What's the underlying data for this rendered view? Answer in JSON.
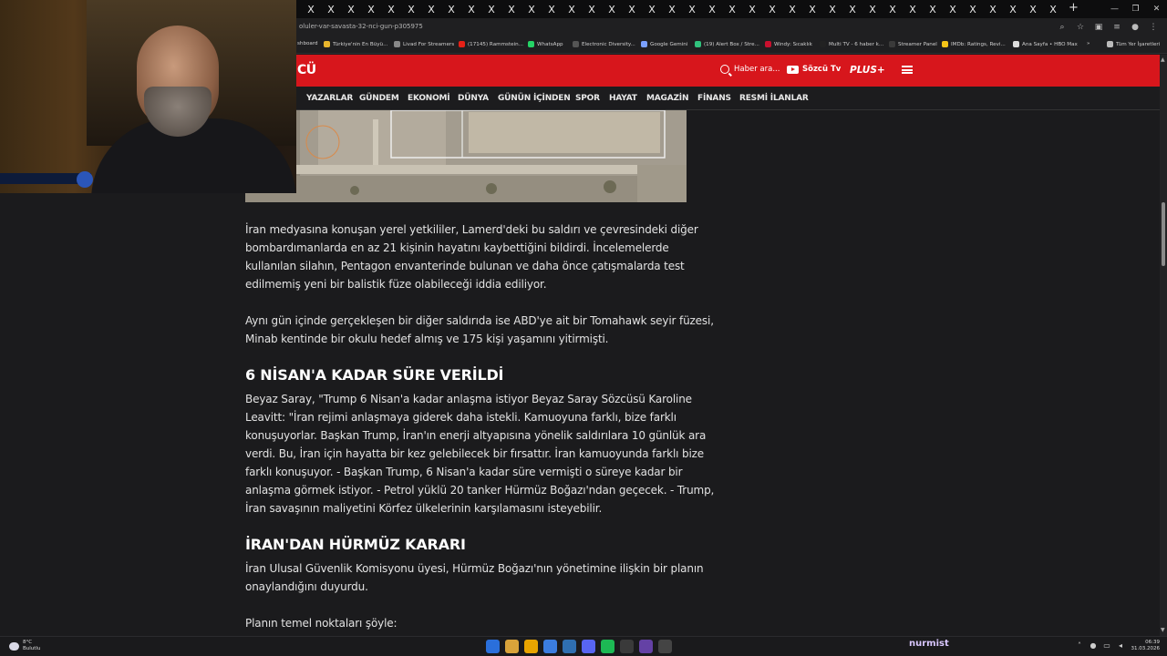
{
  "browser": {
    "tabs": [
      "X",
      "X",
      "X",
      "X",
      "X",
      "X",
      "X",
      "X",
      "X",
      "X",
      "X",
      "X",
      "X",
      "X",
      "X",
      "X",
      "X",
      "X",
      "X",
      "X",
      "X",
      "X",
      "X",
      "X",
      "X",
      "X",
      "X",
      "X",
      "X",
      "X",
      "X",
      "X",
      "X",
      "X",
      "X",
      "X",
      "X",
      "X"
    ],
    "new_tab": "+",
    "url": "oluler-var-savasta-32-nci-gun-p305975",
    "bookmarks": [
      {
        "label": "shboard",
        "icon_color": ""
      },
      {
        "label": "Türkiye'nin En Büyü...",
        "icon_color": "#e8b52c"
      },
      {
        "label": "Livad For Streamers",
        "icon_color": "#888888"
      },
      {
        "label": "(17145) Rammstein...",
        "icon_color": "#e62117"
      },
      {
        "label": "WhatsApp",
        "icon_color": "#25d366"
      },
      {
        "label": "Electronic Diversity...",
        "icon_color": "#555555"
      },
      {
        "label": "Google Gemini",
        "icon_color": "#7aa0ff"
      },
      {
        "label": "(19) Alert Box / Stre...",
        "icon_color": "#30c27d"
      },
      {
        "label": "Windy: Sıcaklık",
        "icon_color": "#c8102e"
      },
      {
        "label": "Multi TV - 6 haber k...",
        "icon_color": "#222222"
      },
      {
        "label": "Streamer Panel",
        "icon_color": "#3a3a3a"
      },
      {
        "label": "IMDb: Ratings, Revi...",
        "icon_color": "#f5c518"
      },
      {
        "label": "Ana Sayfa • HBO Max",
        "icon_color": "#dddddd"
      },
      {
        "label": "»",
        "icon_color": ""
      },
      {
        "label": "Tüm Yer İşaretleri",
        "icon_color": "#bbbbbb"
      }
    ]
  },
  "site": {
    "logo_text": "CÜ",
    "search_label": "Haber ara...",
    "tv_label": "Sözcü Tv",
    "plus_label": "PLUS+",
    "nav": [
      "YAZARLAR",
      "GÜNDEM",
      "EKONOMİ",
      "DÜNYA",
      "GÜNÜN İÇİNDEN",
      "SPOR",
      "HAYAT",
      "MAGAZİN",
      "FİNANS",
      "RESMİ İLANLAR"
    ],
    "brand_color": "#d7161c"
  },
  "article": {
    "p1_lines": [
      "İran medyasına konuşan yerel yetkililer, Lamerd'deki bu saldırı ve çevresindeki diğer",
      "bombardımanlarda en az 21 kişinin hayatını kaybettiğini bildirdi. İncelemelerde",
      "kullanılan silahın, Pentagon envanterinde bulunan ve daha önce çatışmalarda test",
      "edilmemiş yeni bir balistik füze olabileceği iddia ediliyor."
    ],
    "p2_lines": [
      "Aynı gün içinde gerçekleşen bir diğer saldırıda ise ABD'ye ait bir Tomahawk seyir füzesi,",
      "Minab kentinde bir okulu hedef almış ve 175 kişi yaşamını yitirmişti."
    ],
    "h1": "6 NİSAN'A KADAR SÜRE VERİLDİ",
    "p3_lines": [
      "Beyaz Saray, \"Trump 6 Nisan'a kadar anlaşma istiyor Beyaz Saray Sözcüsü Karoline",
      "Leavitt: \"İran rejimi anlaşmaya giderek daha istekli. Kamuoyuna farklı, bize farklı",
      "konuşuyorlar. Başkan Trump, İran'ın enerji altyapısına yönelik saldırılara 10 günlük ara",
      "verdi. Bu, İran için hayatta bir kez gelebilecek bir fırsattır. İran kamuoyunda farklı bize",
      "farklı konuşuyor. - Başkan Trump, 6 Nisan'a kadar süre vermişti o süreye kadar bir",
      "anlaşma görmek istiyor. - Petrol yüklü 20 tanker Hürmüz Boğazı'ndan geçecek. - Trump,",
      "İran savaşının maliyetini Körfez ülkelerinin karşılamasını isteyebilir."
    ],
    "h2": "İRAN'DAN HÜRMÜZ KARARI",
    "p4_lines": [
      "İran Ulusal Güvenlik Komisyonu üyesi, Hürmüz Boğazı'nın yönetimine ilişkin bir planın",
      "onaylandığını duyurdu."
    ],
    "p5": "Planın temel noktaları şöyle:"
  },
  "taskbar": {
    "weather_temp": "8°C",
    "weather_desc": "Bulutlu",
    "streamer_name": "nurmist",
    "time": "06:39",
    "date": "31.03.2026",
    "app_colors": [
      "#2a6fdb",
      "#d9a33a",
      "#e8a400",
      "#3b7de0",
      "#2f6fb0",
      "#5865f2",
      "#1db954",
      "#3a3a3a",
      "#6441a5",
      "#444444"
    ]
  }
}
